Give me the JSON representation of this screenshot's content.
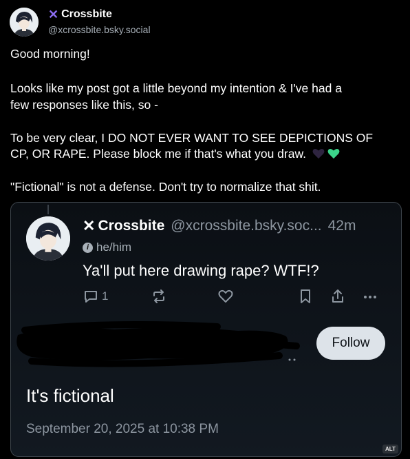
{
  "author": {
    "name": "Crossbite",
    "handle": "@xcrossbite.bsky.social"
  },
  "post": {
    "greeting": "Good morning!",
    "line1": "Looks like my post got a little beyond my intention & I've had a",
    "line2": "few responses like this, so -",
    "line3": "To be very clear, I DO NOT EVER WANT TO SEE DEPICTIONS OF",
    "line4": "CP, OR RAPE. Please block me if that's what you draw.",
    "line5": "\"Fictional\" is not a defense. Don't try to normalize that shit.",
    "hearts": [
      "black-heart",
      "green-heart"
    ]
  },
  "quote": {
    "name": "Crossbite",
    "handle": "@xcrossbite.bsky.soc...",
    "time": "42m",
    "pronouns": "he/him",
    "text": "Ya'll put here drawing rape? WTF!?",
    "reply_count": "1"
  },
  "reply": {
    "follow_label": "Follow",
    "text": "It's fictional",
    "date": "September 20, 2025 at 10:38 PM"
  },
  "alt_label": "ALT",
  "colors": {
    "accent": "#8b6cf0",
    "follow_bg": "#dde3e9",
    "muted": "#8d96a0"
  }
}
